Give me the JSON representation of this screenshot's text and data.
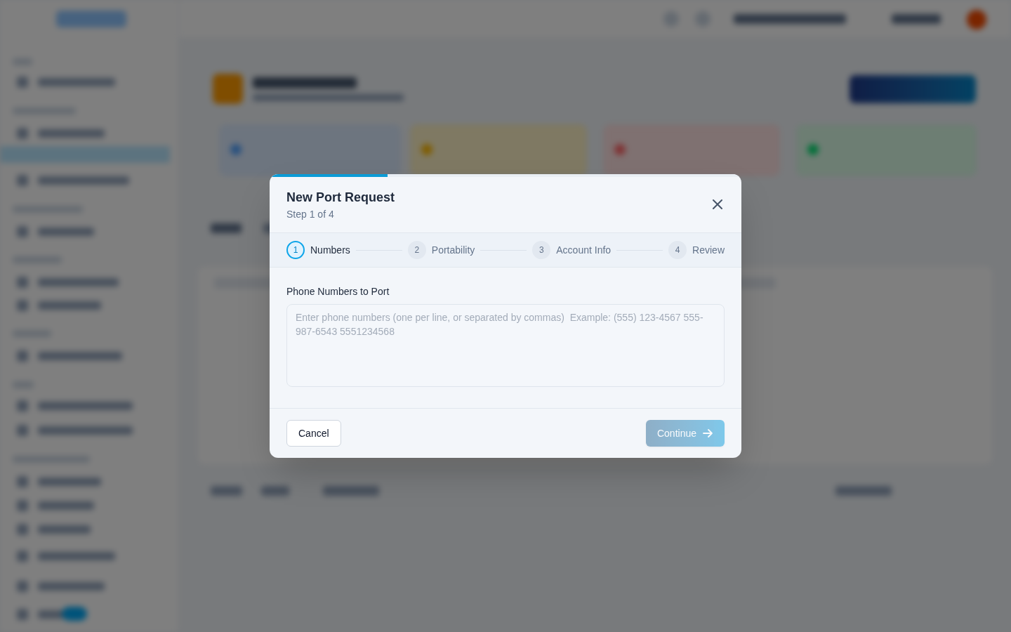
{
  "dialog": {
    "progress": {
      "level": 0.25
    },
    "title": "New Port Request",
    "subtitle": "Step 1 of 4",
    "steps": [
      {
        "number": "1",
        "label": "Numbers",
        "selected": true
      },
      {
        "number": "2",
        "label": "Portability",
        "selected": false
      },
      {
        "number": "3",
        "label": "Account Info",
        "selected": false
      },
      {
        "number": "4",
        "label": "Review",
        "selected": false
      }
    ],
    "field": {
      "label": "Phone Numbers to Port",
      "placeholder": "Enter phone numbers (one per line, or separated by commas)  Example: (555) 123-4567 555-987-6543 5551234568"
    },
    "buttons": [
      {
        "kind": "secondary",
        "label": "Cancel",
        "disabled": false
      },
      {
        "kind": "primary",
        "label": "Continue",
        "disabled": true
      }
    ]
  }
}
